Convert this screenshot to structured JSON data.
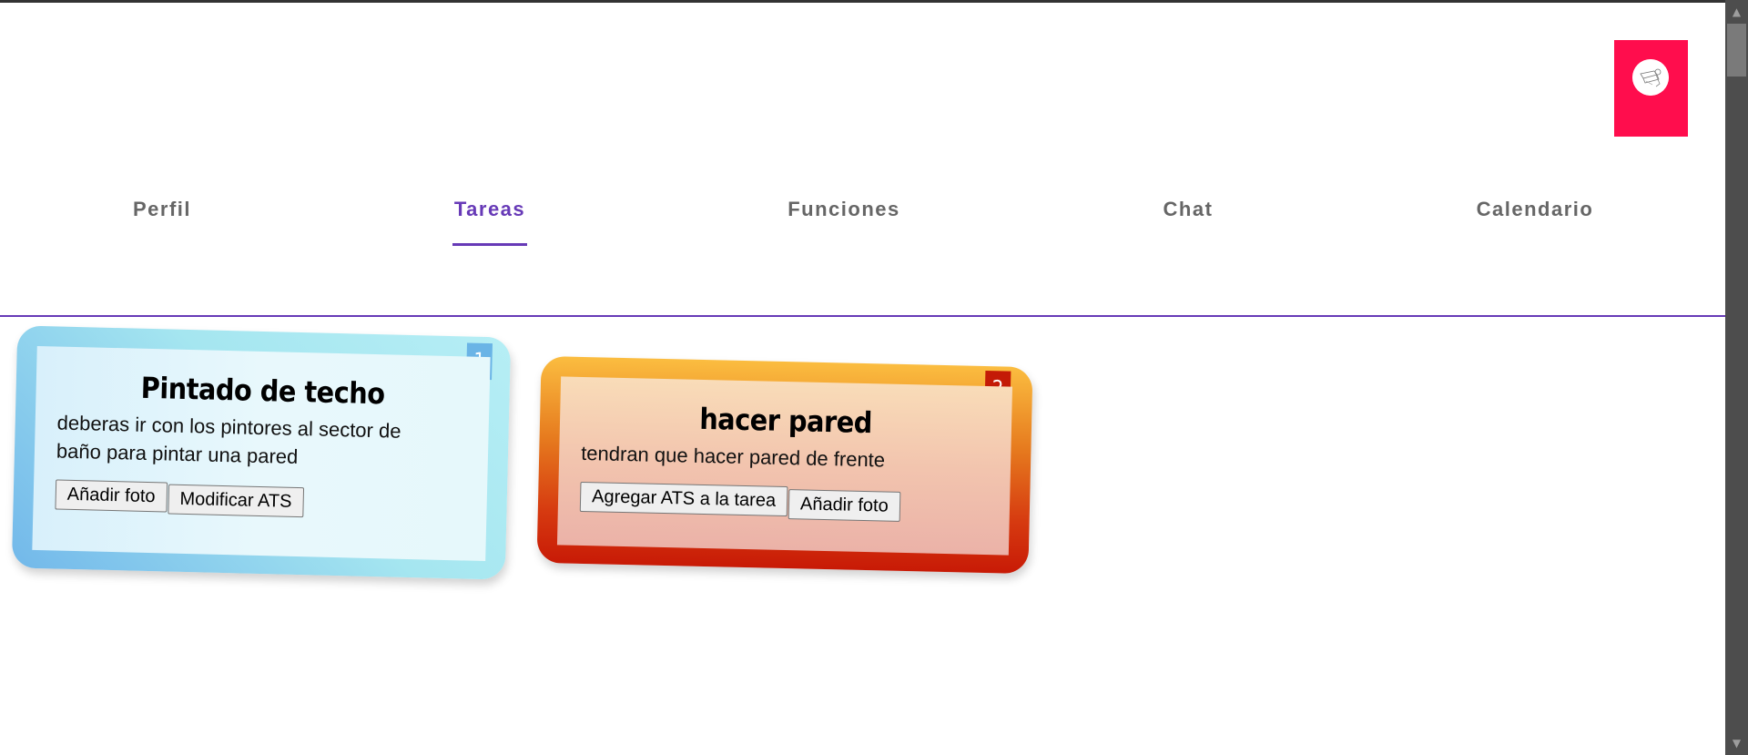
{
  "user": {
    "avatar_icon": "user-avatar-icon",
    "avatar_bg": "#ff0d4d"
  },
  "nav": {
    "tabs": [
      {
        "label": "Perfil",
        "active": false
      },
      {
        "label": "Tareas",
        "active": true
      },
      {
        "label": "Funciones",
        "active": false
      },
      {
        "label": "Chat",
        "active": false
      },
      {
        "label": "Calendario",
        "active": false
      }
    ],
    "accent_color": "#673ab7"
  },
  "tasks": [
    {
      "number": "1",
      "title": "Pintado de techo",
      "description_line1": "deberas ir con los pintores al sector de",
      "description_line2": "baño para pintar una pared",
      "buttons": [
        "Añadir foto",
        "Modificar ATS"
      ],
      "theme": "blue"
    },
    {
      "number": "2",
      "title": "hacer pared",
      "description_line1": "tendran que hacer pared de frente",
      "buttons": [
        "Agregar ATS a la tarea",
        "Añadir foto"
      ],
      "theme": "orange"
    }
  ]
}
